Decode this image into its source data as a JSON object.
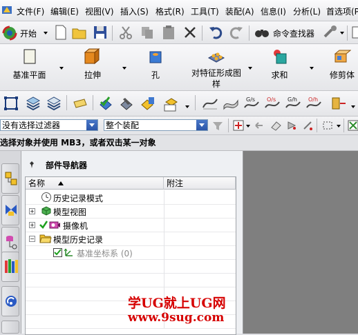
{
  "menu": {
    "items": [
      "文件(F)",
      "编辑(E)",
      "视图(V)",
      "插入(S)",
      "格式(R)",
      "工具(T)",
      "装配(A)",
      "信息(I)",
      "分析(L)",
      "首选项(P"
    ]
  },
  "standard_toolbar": {
    "start_label": "开始",
    "command_finder_label": "命令查找器"
  },
  "feature_toolbar": {
    "items": [
      "基准平面",
      "拉伸",
      "孔",
      "对特征形成图样",
      "求和",
      "修剪体"
    ]
  },
  "selection_bar": {
    "filter_value": "没有选择过滤器",
    "scope_value": "整个装配"
  },
  "status_line": "选择对象并使用 MB3，或者双击某一对象",
  "navigator": {
    "title": "部件导航器",
    "columns": [
      "名称",
      "附注"
    ],
    "rows": [
      {
        "label": "历史记录模式",
        "note": ""
      },
      {
        "label": "模型视图",
        "note": ""
      },
      {
        "label": "摄像机",
        "note": ""
      },
      {
        "label": "模型历史记录",
        "note": ""
      },
      {
        "label": "基准坐标系 (0)",
        "note": ""
      }
    ]
  },
  "watermark": {
    "line1": "学UG就上UG网",
    "line2": "www.9sug.com"
  },
  "colors": {
    "watermark": "#d60000",
    "canvas_grey": "#7f7f7f",
    "combo_arrow": "#2b55a8"
  }
}
